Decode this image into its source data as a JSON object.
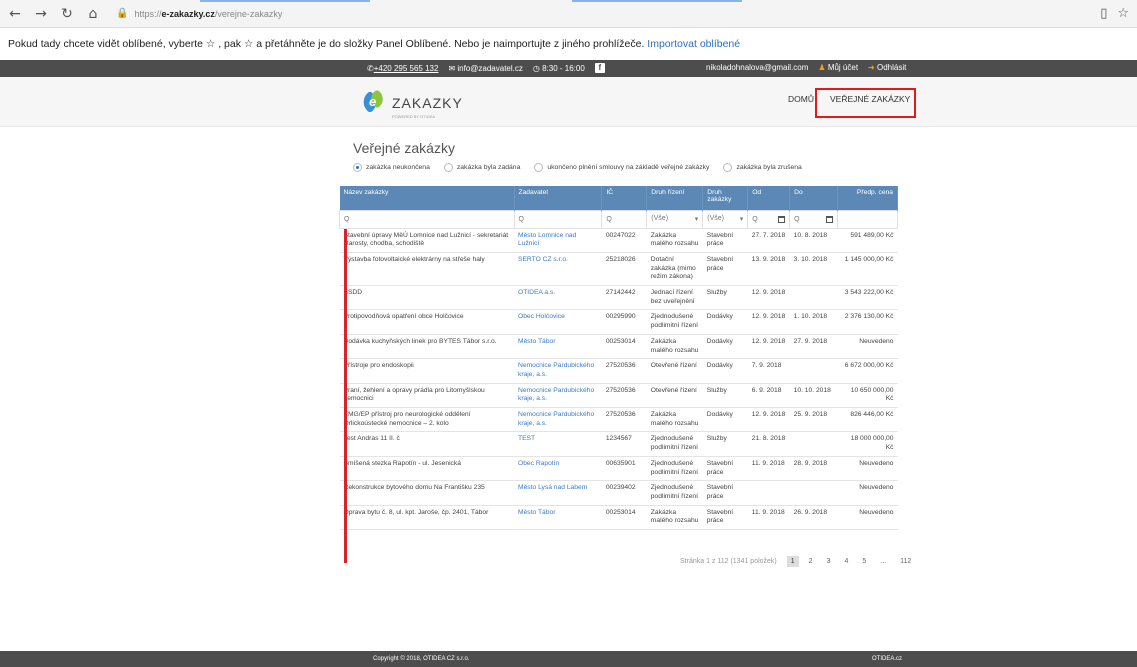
{
  "browser": {
    "url_prefix": "https://",
    "url_domain": "e-zakazky.cz",
    "url_path": "/verejne-zakazky",
    "back_icon": "←",
    "forward_icon": "→",
    "reload_icon": "↻",
    "home_icon": "⌂",
    "lock_icon": "🔒",
    "reading_icon": "▯",
    "star_icon": "☆"
  },
  "favorites_bar": {
    "text": "Pokud tady chcete vidět oblíbené, vyberte ☆ , pak ☆ a přetáhněte je do složky Panel Oblíbené. Nebo je naimportujte z jiného prohlížeče.",
    "link": "Importovat oblíbené"
  },
  "topbar": {
    "phone": "+420 295 565 132",
    "email": "info@zadavatel.cz",
    "hours": "8:30 - 16:00",
    "facebook": "f",
    "user_email": "nikoladohnalova@gmail.com",
    "account": "Můj účet",
    "logout": "Odhlásit"
  },
  "header": {
    "logo_text": "ZAKAZKY",
    "logo_e": "e",
    "logo_sub": "POWERED BY OTIDEA",
    "menu": [
      "DOMŮ",
      "VEŘEJNÉ ZAKÁZKY"
    ]
  },
  "page_title": "Veřejné zakázky",
  "filters": [
    {
      "label": "zakázka neukončena",
      "selected": true
    },
    {
      "label": "zakázka byla zadána",
      "selected": false
    },
    {
      "label": "ukončeno plnění smlouvy na základě veřejné zakázky",
      "selected": false
    },
    {
      "label": "zakázka byla zrušena",
      "selected": false
    }
  ],
  "table": {
    "columns": [
      "Název zakázky",
      "Zadavatel",
      "IČ",
      "Druh řízení",
      "Druh zakázky",
      "Od",
      "Do",
      "Předp. cena"
    ],
    "filter_row": {
      "search": "Q",
      "select_all": "(Vše)"
    },
    "rows": [
      [
        "Stavební úpravy MěÚ Lomnice nad Lužnicí - sekretariát starosty, chodba, schodiště",
        "Město Lomnice nad Lužnicí",
        "00247022",
        "Zakázka malého rozsahu",
        "Stavební práce",
        "27. 7. 2018",
        "10. 8. 2018",
        "591 489,00 Kč"
      ],
      [
        "Výstavba fotovoltaické elektrárny na střeše haly",
        "SERTO CZ s.r.o.",
        "25218026",
        "Dotační zakázka (mimo režim zákona)",
        "Stavební práce",
        "13. 9. 2018",
        "3. 10. 2018",
        "1 145 000,00 Kč"
      ],
      [
        "SSDD",
        "OTIDEA a.s.",
        "27142442",
        "Jednací řízení bez uveřejnění",
        "Služby",
        "12. 9. 2018",
        "",
        "3 543 222,00 Kč"
      ],
      [
        "Protipovodňová opatření obce Holčovice",
        "Obec Holčovice",
        "00295990",
        "Zjednodušené podlimitní řízení",
        "Dodávky",
        "12. 9. 2018",
        "1. 10. 2018",
        "2 376 130,00 Kč"
      ],
      [
        "Dodávka kuchyňských linek pro BYTES Tábor s.r.o.",
        "Město Tábor",
        "00253014",
        "Zakázka malého rozsahu",
        "Dodávky",
        "12. 9. 2018",
        "27. 9. 2018",
        "Neuvedeno"
      ],
      [
        "Přístroje pro endoskopii",
        "Nemocnice Pardubického kraje, a.s.",
        "27520536",
        "Otevřené řízení",
        "Dodávky",
        "7. 9. 2018",
        "",
        "6 672 000,00 Kč"
      ],
      [
        "Praní, žehlení a opravy prádla pro Litomyšlskou nemocnici",
        "Nemocnice Pardubického kraje, a.s.",
        "27520536",
        "Otevřené řízení",
        "Služby",
        "6. 9. 2018",
        "10. 10. 2018",
        "10 650 000,00 Kč"
      ],
      [
        "EMG/EP přístroj pro neurologické oddělení Orlickoústecké nemocnice – 2. kolo",
        "Nemocnice Pardubického kraje, a.s.",
        "27520536",
        "Zakázka malého rozsahu",
        "Dodávky",
        "12. 9. 2018",
        "25. 9. 2018",
        "826 446,00 Kč"
      ],
      [
        "Test Andras 11 II. č",
        "TEST",
        "1234567",
        "Zjednodušené podlimitní řízení",
        "Služby",
        "21. 8. 2018",
        "",
        "18 000 000,00 Kč"
      ],
      [
        "Smíšená stezka Rapotín - ul. Jesenická",
        "Obec Rapotín",
        "00635901",
        "Zjednodušené podlimitní řízení",
        "Stavební práce",
        "11. 9. 2018",
        "28. 9. 2018",
        "Neuvedeno"
      ],
      [
        "Rekonstrukce bytového domu Na Františku 235",
        "Město Lysá nad Labem",
        "00239402",
        "Zjednodušené podlimitní řízení",
        "Stavební práce",
        "",
        "",
        "Neuvedeno"
      ],
      [
        "Oprava bytu č. 8, ul. kpt. Jaroše, čp. 2401, Tábor",
        "Město Tábor",
        "00253014",
        "Zakázka malého rozsahu",
        "Stavební práce",
        "11. 9. 2018",
        "26. 9. 2018",
        "Neuvedeno"
      ]
    ]
  },
  "pager": {
    "info": "Stránka 1 z 112 (1341 položek)",
    "pages": [
      "1",
      "2",
      "3",
      "4",
      "5",
      "...",
      "112"
    ]
  },
  "footer": {
    "copyright": "Copyright © 2018, OTIDEA CZ s.r.o.",
    "brand": "OTIDEA.cz"
  },
  "colors": {
    "header_blue": "#5b88b5",
    "link": "#3b7cc6",
    "highlight": "#e01b1b",
    "dark_bar": "#4d4d4d"
  }
}
